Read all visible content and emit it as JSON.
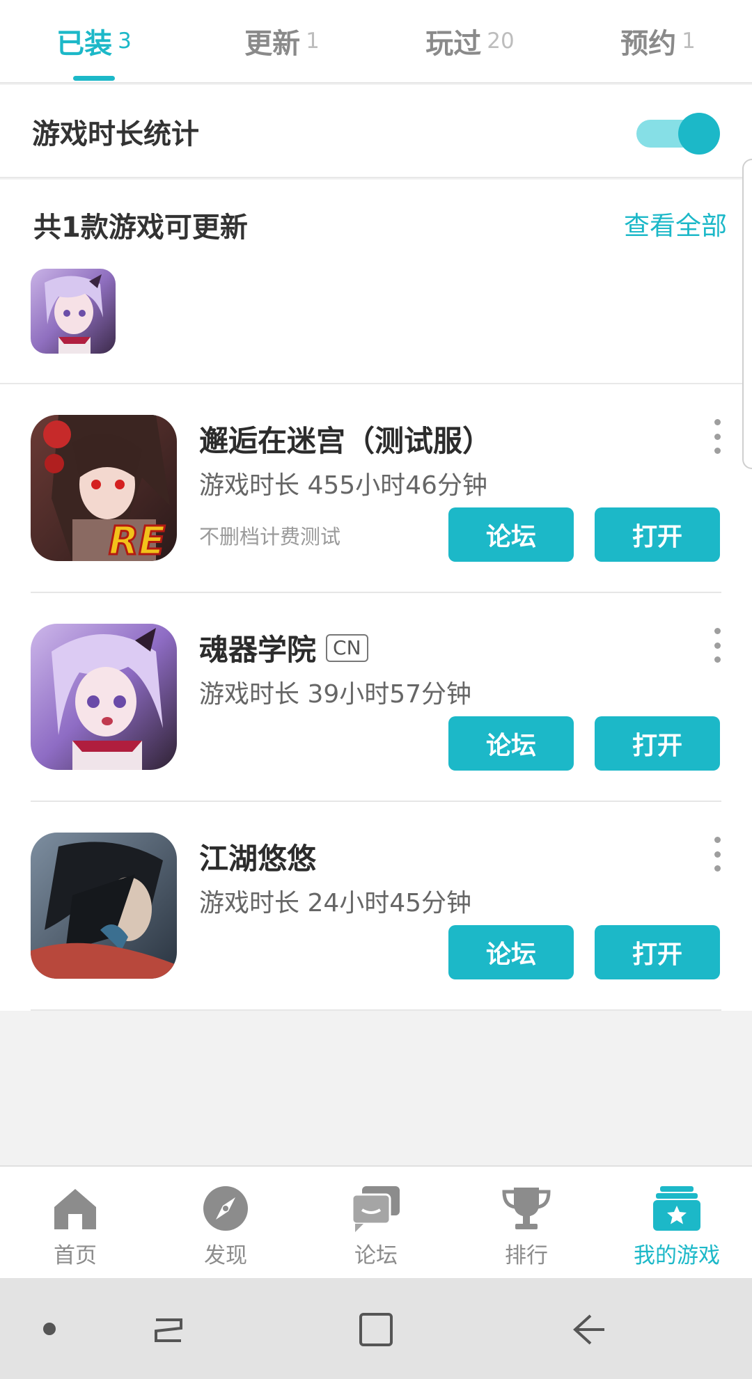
{
  "tabs": [
    {
      "label": "已装",
      "count": "3",
      "active": true
    },
    {
      "label": "更新",
      "count": "1",
      "active": false
    },
    {
      "label": "玩过",
      "count": "20",
      "active": false
    },
    {
      "label": "预约",
      "count": "1",
      "active": false
    }
  ],
  "stats": {
    "label": "游戏时长统计",
    "toggle_on": true
  },
  "updates": {
    "title": "共1款游戏可更新",
    "view_all": "查看全部"
  },
  "games": [
    {
      "name": "邂逅在迷宫（测试服）",
      "tag": "",
      "playtime": "游戏时长 455小时46分钟",
      "subtitle": "不删档计费测试",
      "forum_label": "论坛",
      "open_label": "打开"
    },
    {
      "name": "魂器学院",
      "tag": "CN",
      "playtime": "游戏时长 39小时57分钟",
      "subtitle": "",
      "forum_label": "论坛",
      "open_label": "打开"
    },
    {
      "name": "江湖悠悠",
      "tag": "",
      "playtime": "游戏时长 24小时45分钟",
      "subtitle": "",
      "forum_label": "论坛",
      "open_label": "打开"
    }
  ],
  "bottom_nav": [
    {
      "label": "首页",
      "icon": "home-icon",
      "active": false
    },
    {
      "label": "发现",
      "icon": "compass-icon",
      "active": false
    },
    {
      "label": "论坛",
      "icon": "chat-icon",
      "active": false
    },
    {
      "label": "排行",
      "icon": "trophy-icon",
      "active": false
    },
    {
      "label": "我的游戏",
      "icon": "game-box-icon",
      "active": true
    }
  ],
  "colors": {
    "accent": "#1cb8c8",
    "toggle_track": "#86dfe6"
  }
}
